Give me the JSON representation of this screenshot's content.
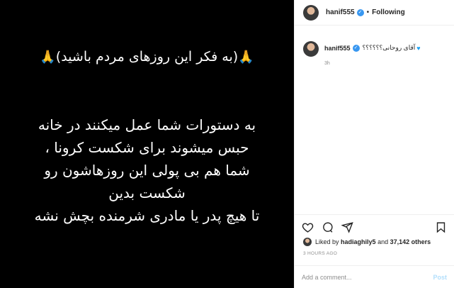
{
  "image": {
    "title": "(به فکر این روزهای مردم باشید)",
    "title_emoji": "🙏",
    "body_lines": [
      "به دستورات شما عمل میکنند در خانه",
      "حبس میشوند برای شکست کرونا ،",
      "شما هم بی پولی این روزهاشون رو",
      "شکست بدین",
      "تا هیچ پدر یا مادری شرمنده بچش نشه"
    ]
  },
  "header": {
    "username": "hanif555",
    "separator": "•",
    "follow_label": "Following"
  },
  "caption": {
    "username": "hanif555",
    "text": "آقای روحانی؟؟؟؟؟؟",
    "time": "3h"
  },
  "likes": {
    "prefix": "Liked by",
    "user": "hadiaghily5",
    "middle": "and",
    "count": "37,142 others"
  },
  "timestamp": "3 HOURS AGO",
  "comment_box": {
    "placeholder": "Add a comment...",
    "post_label": "Post"
  },
  "icons": [
    "heart-icon",
    "comment-icon",
    "share-icon",
    "bookmark-icon",
    "verified-icon"
  ]
}
